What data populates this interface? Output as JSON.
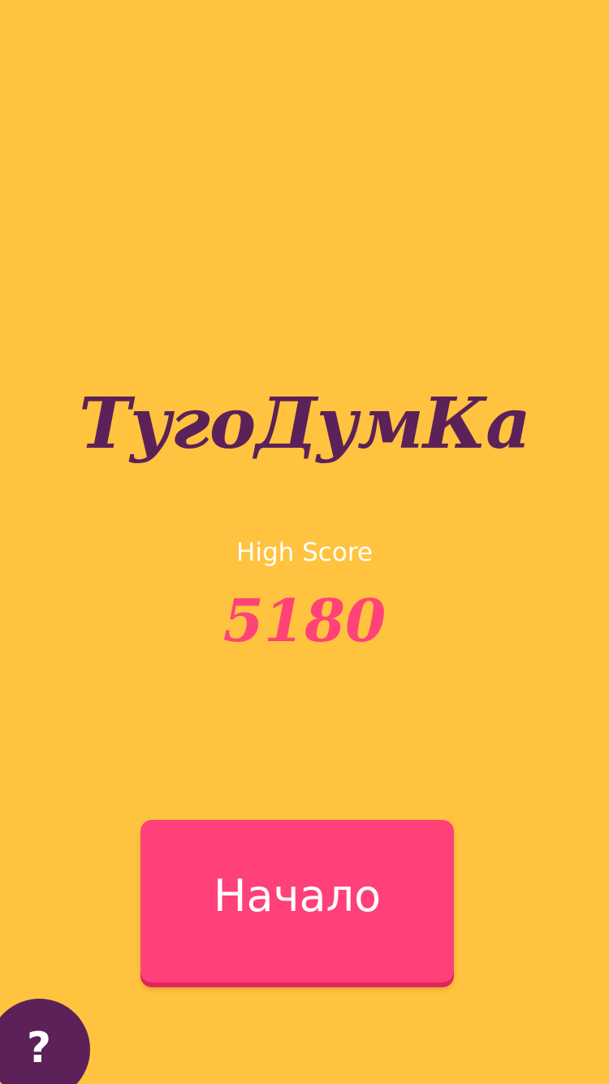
{
  "game": {
    "title": "ТугоДумКа"
  },
  "high_score": {
    "label": "High Score",
    "value": "5180"
  },
  "start_button": {
    "label": "Начало"
  },
  "help_button": {
    "icon": "question-mark-icon",
    "glyph": "?"
  },
  "colors": {
    "background": "#FFC33F",
    "title": "#5C2158",
    "score": "#FF4278",
    "button": "#FF4079",
    "button_shadow": "#E0245E",
    "help_button": "#5C2158",
    "label": "#FFFFFF"
  }
}
